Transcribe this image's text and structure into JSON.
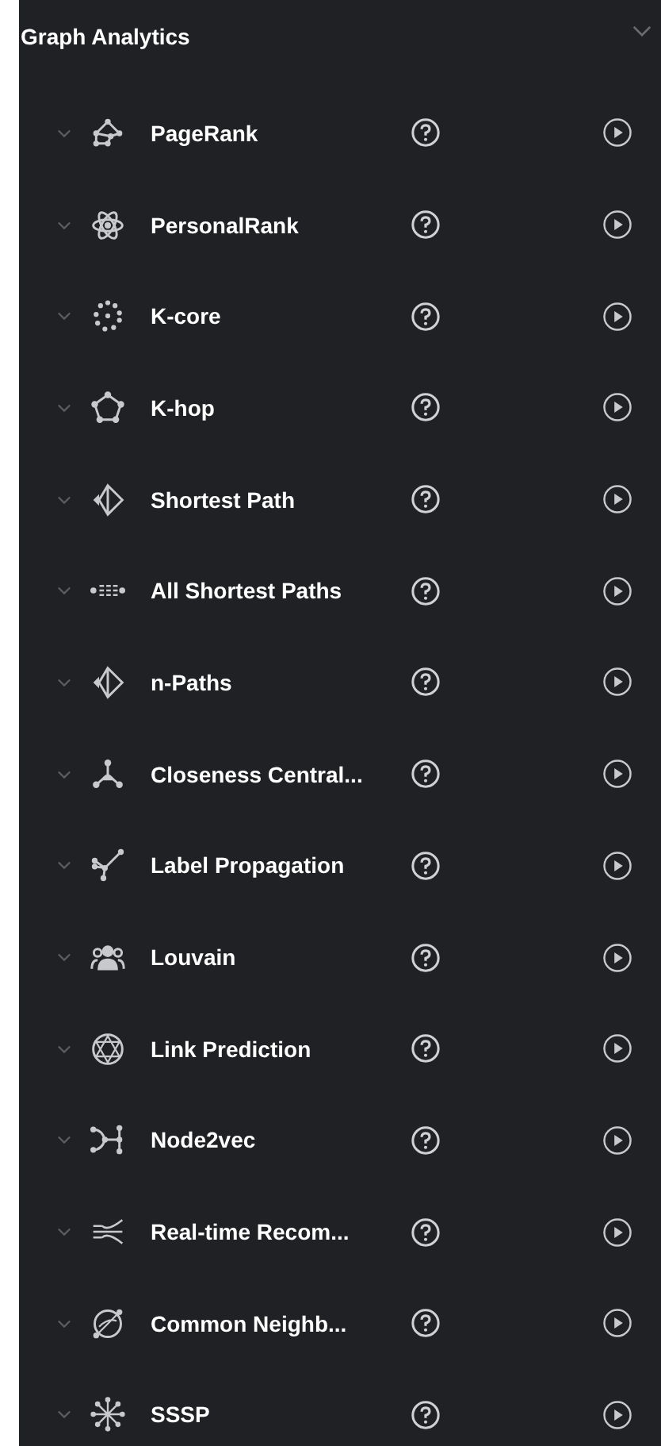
{
  "panel": {
    "title": "Graph Analytics"
  },
  "algorithms": [
    {
      "label": "PageRank"
    },
    {
      "label": "PersonalRank"
    },
    {
      "label": "K-core"
    },
    {
      "label": "K-hop"
    },
    {
      "label": "Shortest Path"
    },
    {
      "label": "All Shortest Paths"
    },
    {
      "label": "n-Paths"
    },
    {
      "label": "Closeness Central..."
    },
    {
      "label": "Label Propagation"
    },
    {
      "label": "Louvain"
    },
    {
      "label": "Link Prediction"
    },
    {
      "label": "Node2vec"
    },
    {
      "label": "Real-time Recom..."
    },
    {
      "label": "Common Neighb..."
    },
    {
      "label": "SSSP"
    }
  ]
}
